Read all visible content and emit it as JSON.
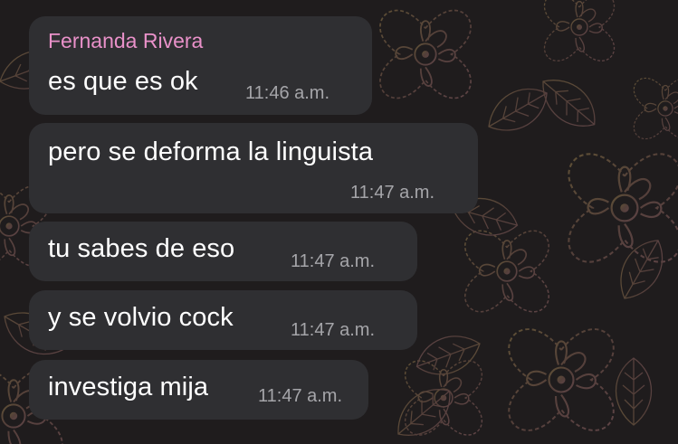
{
  "chat": {
    "background_color": "#1f1c1d",
    "bubble_color": "#2f2f32",
    "sender_color": "#e991c9",
    "time_color": "#a5a5a9",
    "sender_name": "Fernanda Rivera",
    "messages": [
      {
        "text": "es que es ok",
        "time": "11:46 a.m."
      },
      {
        "text": "pero se deforma la linguista",
        "time": "11:47 a.m."
      },
      {
        "text": "tu sabes de eso",
        "time": "11:47 a.m."
      },
      {
        "text": "y se volvio cock",
        "time": "11:47 a.m."
      },
      {
        "text": "investiga mija",
        "time": "11:47 a.m."
      }
    ]
  }
}
